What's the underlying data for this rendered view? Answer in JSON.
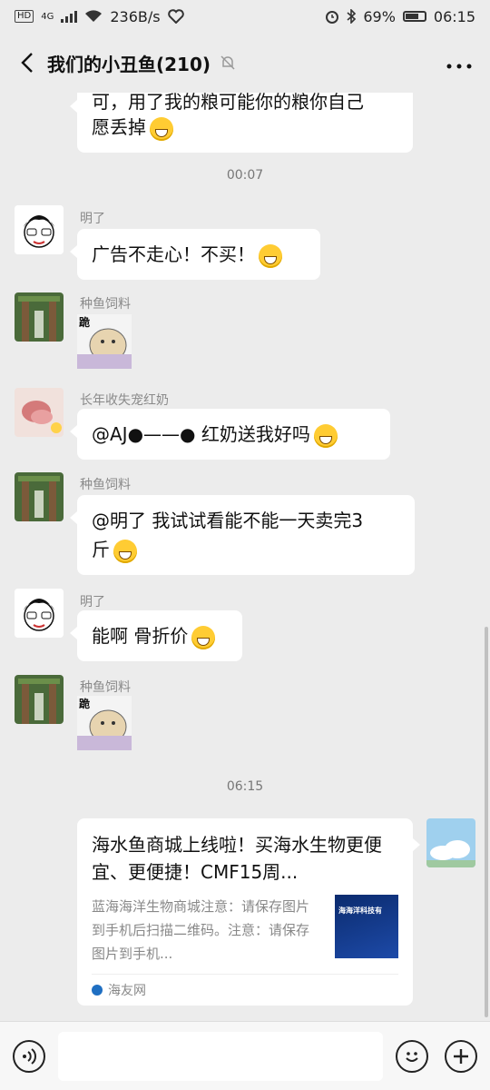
{
  "status_bar": {
    "network": "4G",
    "speed": "236B/s",
    "battery": "69%",
    "time": "06:15",
    "icons": [
      "hd-icon",
      "signal-icon",
      "wifi-icon",
      "heart-pulse-icon",
      "alarm-icon",
      "bluetooth-icon",
      "battery-icon"
    ]
  },
  "header": {
    "title": "我们的小丑鱼(210)",
    "back_icon": "chevron-left-icon",
    "mute_icon": "bell-muted-icon",
    "more_icon": "more-icon"
  },
  "messages": [
    {
      "type": "text_partial",
      "text_line1": "可，用了我的粮可能你的粮你自己",
      "text_line2": "愿丢掉",
      "emoji": "laugh-cry-emoji"
    },
    {
      "type": "time",
      "text": "00:07"
    },
    {
      "type": "text",
      "sender": "明了",
      "text": "广告不走心！不买！",
      "emoji": "grin-emoji"
    },
    {
      "type": "sticker",
      "sender": "种鱼饲料",
      "caption": "跪"
    },
    {
      "type": "text",
      "sender": "长年收失宠红奶",
      "text": "@AJ●——●  红奶送我好吗",
      "emoji": "heart-eyes-emoji"
    },
    {
      "type": "text",
      "sender": "种鱼饲料",
      "text_line1": "@明了  我试试看能不能一天卖完3",
      "text_line2": "斤",
      "emoji": "laugh-cry-emoji"
    },
    {
      "type": "text",
      "sender": "明了",
      "text": "能啊 骨折价",
      "emoji": "grin-emoji"
    },
    {
      "type": "sticker",
      "sender": "种鱼饲料",
      "caption": "跪"
    },
    {
      "type": "time",
      "text": "06:15"
    },
    {
      "type": "link_card",
      "title": "海水鱼商城上线啦！买海水生物更便宜、更便捷！CMF15周...",
      "description": "蓝海海洋生物商城注意：请保存图片到手机后扫描二维码。注意：请保存图片到手机...",
      "thumb_text": "海海洋科技有",
      "source": "海友网"
    }
  ],
  "input_bar": {
    "voice_icon": "voice-icon",
    "emoji_icon": "smile-icon",
    "add_icon": "plus-icon"
  },
  "colors": {
    "background": "#ececec",
    "bubble": "#ffffff",
    "text": "#111111",
    "meta": "#8a8a8a"
  }
}
